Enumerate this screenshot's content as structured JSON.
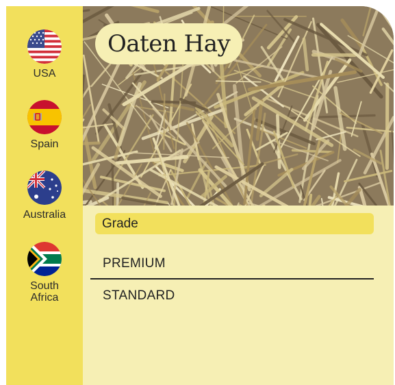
{
  "product": {
    "title": "Oaten Hay"
  },
  "countries": [
    {
      "name": "USA",
      "flag_icon": "us-flag-icon"
    },
    {
      "name": "Spain",
      "flag_icon": "spain-flag-icon"
    },
    {
      "name": "Australia",
      "flag_icon": "australia-flag-icon"
    },
    {
      "name_line1": "South",
      "name_line2": "Africa",
      "flag_icon": "south-africa-flag-icon"
    }
  ],
  "grade": {
    "label": "Grade",
    "options": [
      "PREMIUM",
      "STANDARD"
    ]
  },
  "colors": {
    "sidebar": "#f2e05c",
    "panel": "#f6efb4",
    "text": "#222222"
  }
}
